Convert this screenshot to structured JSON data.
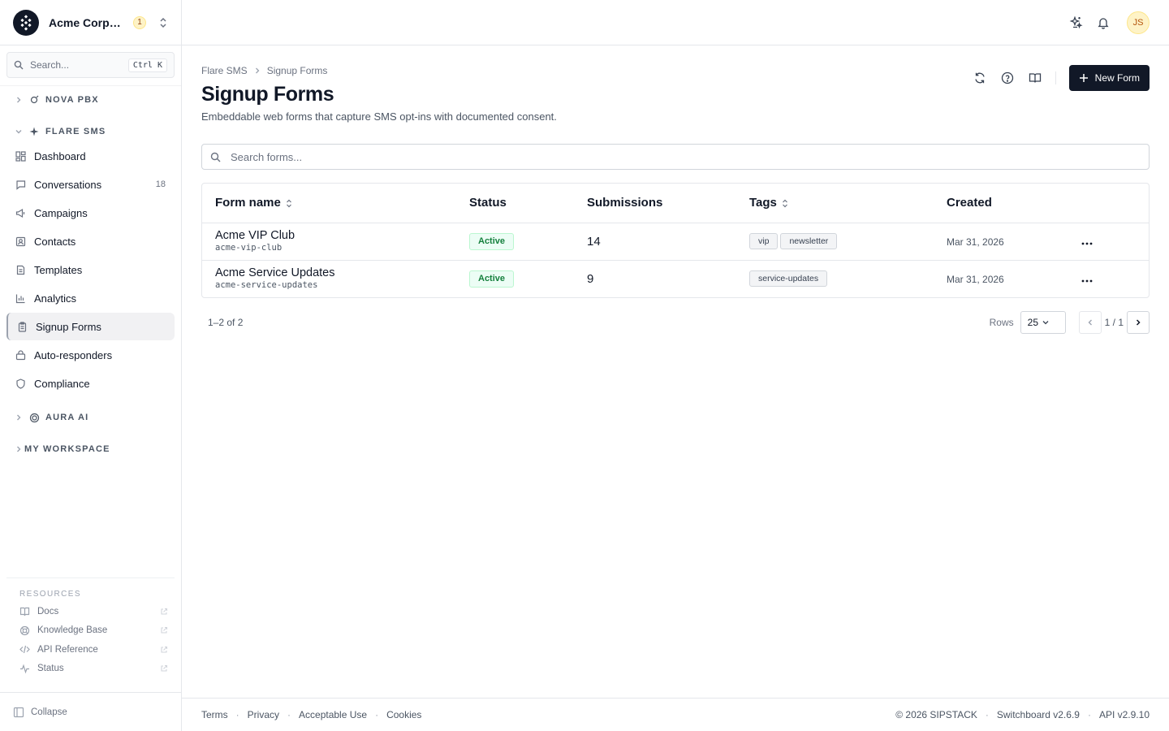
{
  "org": {
    "name": "Acme Corporation",
    "notification_count": "1"
  },
  "search": {
    "placeholder": "Search...",
    "shortcut": "Ctrl K"
  },
  "nav": {
    "groups": {
      "nova_pbx": "NOVA PBX",
      "flare_sms": "FLARE SMS",
      "aura_ai": "AURA AI",
      "my_workspace": "MY WORKSPACE"
    },
    "items": [
      {
        "label": "Dashboard",
        "icon": "dashboard-icon"
      },
      {
        "label": "Conversations",
        "icon": "chat-icon",
        "count": "18"
      },
      {
        "label": "Campaigns",
        "icon": "megaphone-icon"
      },
      {
        "label": "Contacts",
        "icon": "contact-card-icon"
      },
      {
        "label": "Templates",
        "icon": "template-icon"
      },
      {
        "label": "Analytics",
        "icon": "bar-chart-icon"
      },
      {
        "label": "Signup Forms",
        "icon": "clipboard-icon",
        "active": true
      },
      {
        "label": "Auto-responders",
        "icon": "robot-icon"
      },
      {
        "label": "Compliance",
        "icon": "shield-icon"
      }
    ]
  },
  "resources": {
    "title": "RESOURCES",
    "items": [
      {
        "label": "Docs",
        "icon": "book-icon"
      },
      {
        "label": "Knowledge Base",
        "icon": "lifebuoy-icon"
      },
      {
        "label": "API Reference",
        "icon": "code-icon"
      },
      {
        "label": "Status",
        "icon": "activity-icon"
      }
    ]
  },
  "collapse_label": "Collapse",
  "topbar": {
    "avatar_initials": "JS"
  },
  "page": {
    "breadcrumb": [
      "Flare SMS",
      "Signup Forms"
    ],
    "title": "Signup Forms",
    "subtitle": "Embeddable web forms that capture SMS opt-ins with documented consent.",
    "new_button": "New Form",
    "filter_placeholder": "Search forms..."
  },
  "table": {
    "columns": [
      "Form name",
      "Status",
      "Submissions",
      "Tags",
      "Created"
    ],
    "rows": [
      {
        "name": "Acme VIP Club",
        "slug": "acme-vip-club",
        "status": "Active",
        "submissions": "14",
        "tags": [
          "vip",
          "newsletter"
        ],
        "created": "Mar 31, 2026"
      },
      {
        "name": "Acme Service Updates",
        "slug": "acme-service-updates",
        "status": "Active",
        "submissions": "9",
        "tags": [
          "service-updates"
        ],
        "created": "Mar 31, 2026"
      }
    ]
  },
  "pagination": {
    "range": "1–2 of 2",
    "rows_label": "Rows",
    "rows_value": "25",
    "page": "1 / 1"
  },
  "footer": {
    "links": [
      "Terms",
      "Privacy",
      "Acceptable Use",
      "Cookies"
    ],
    "copyright": "© 2026 SIPSTACK",
    "version": "Switchboard v2.6.9",
    "api": "API v2.9.10"
  },
  "colors": {
    "primary": "#111827",
    "active_green": "#15803d",
    "border": "#e5e7eb"
  }
}
